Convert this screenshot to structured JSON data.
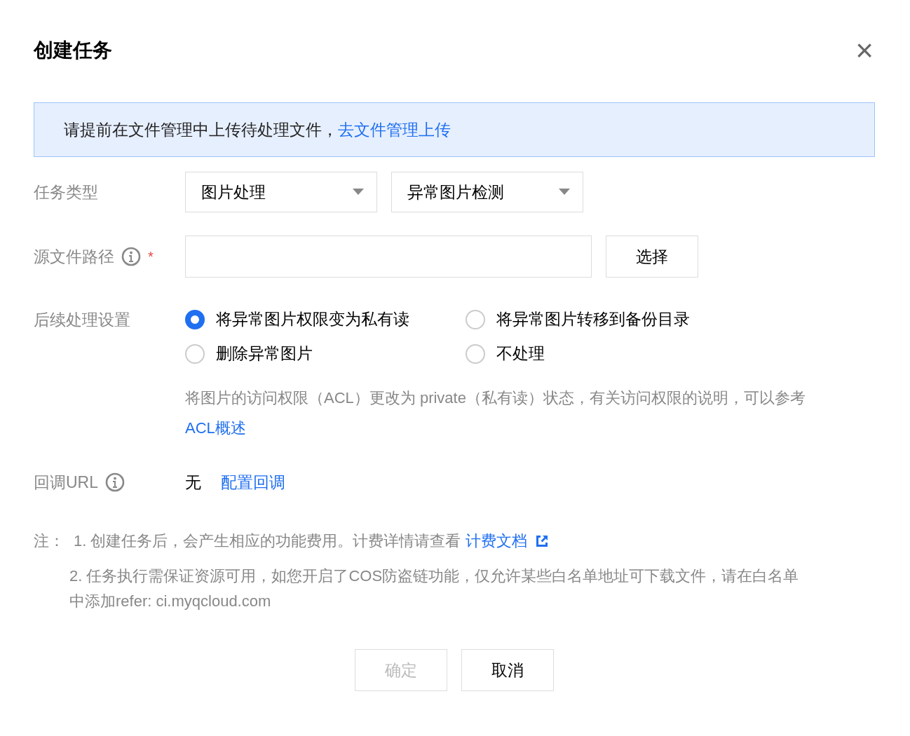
{
  "dialog": {
    "title": "创建任务",
    "close": "×"
  },
  "notice": {
    "text": "请提前在文件管理中上传待处理文件，",
    "link": "去文件管理上传"
  },
  "task_type": {
    "label": "任务类型",
    "selects": [
      {
        "value": "图片处理"
      },
      {
        "value": "异常图片检测"
      }
    ]
  },
  "source_path": {
    "label": "源文件路径",
    "required": true,
    "required_mark": "*",
    "button": "选择"
  },
  "post_processing": {
    "label": "后续处理设置",
    "options": [
      {
        "label": "将异常图片权限变为私有读",
        "selected": true
      },
      {
        "label": "将异常图片转移到备份目录",
        "selected": false
      },
      {
        "label": "删除异常图片",
        "selected": false
      },
      {
        "label": "不处理",
        "selected": false
      }
    ],
    "description": "将图片的访问权限（ACL）更改为 private（私有读）状态，有关访问权限的说明，可以参考",
    "description_link": "ACL概述"
  },
  "callback": {
    "label": "回调URL",
    "value": "无",
    "link": "配置回调"
  },
  "notes": {
    "label": "注：",
    "items": [
      {
        "text": "1. 创建任务后，会产生相应的功能费用。计费详情请查看",
        "link": "计费文档",
        "external": true
      },
      {
        "text": "2. 任务执行需保证资源可用，如您开启了COS防盗链功能，仅允许某些白名单地址可下载文件，请在白名单中添加refer: ci.myqcloud.com",
        "external": false
      }
    ]
  },
  "buttons": [
    {
      "label": "确定",
      "disabled": true
    },
    {
      "label": "取消",
      "disabled": false
    }
  ]
}
